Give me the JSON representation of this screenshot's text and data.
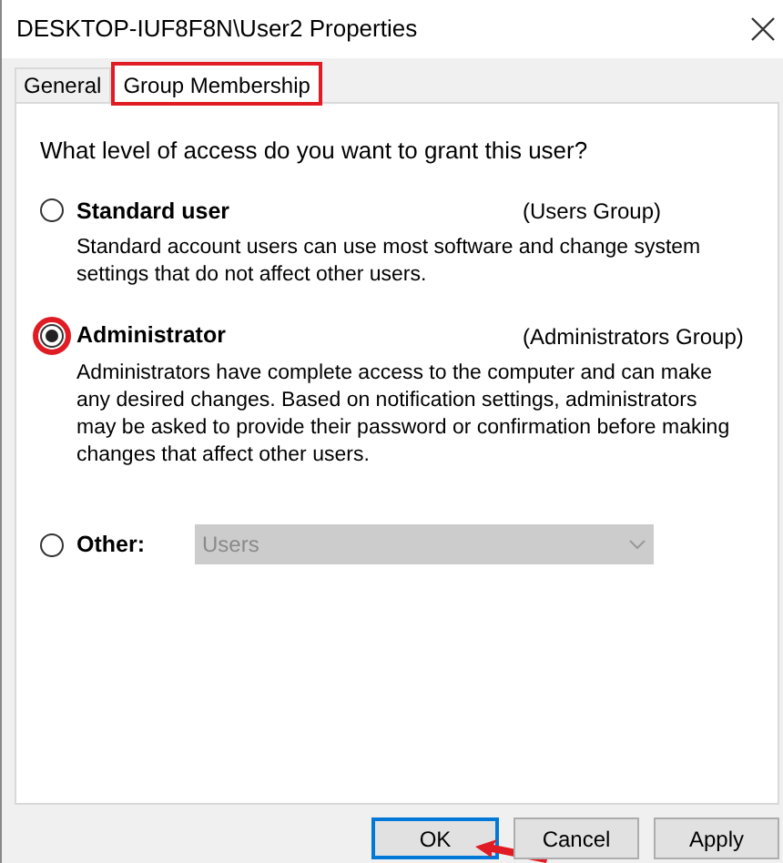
{
  "window": {
    "title": "DESKTOP-IUF8F8N\\User2 Properties"
  },
  "tabs": [
    {
      "label": "General",
      "selected": false,
      "highlighted": false
    },
    {
      "label": "Group Membership",
      "selected": true,
      "highlighted": true
    }
  ],
  "question": "What level of access do you want to grant this user?",
  "options": [
    {
      "kind": "described",
      "label": "Standard user",
      "group": "(Users Group)",
      "description": "Standard account users can use most software and change system settings that do not affect other users.",
      "selected": false,
      "highlighted": false
    },
    {
      "kind": "described",
      "label": "Administrator",
      "group": "(Administrators Group)",
      "description": "Administrators have complete access to the computer and can make any desired changes. Based on notification settings, administrators may be asked to provide their password or confirmation before making changes that affect other users.",
      "selected": true,
      "highlighted": true
    },
    {
      "kind": "dropdown",
      "label": "Other:",
      "value": "Users",
      "disabled": true,
      "selected": false,
      "highlighted": false
    }
  ],
  "buttons": [
    {
      "label": "OK",
      "default": true,
      "pointed": true
    },
    {
      "label": "Cancel",
      "default": false,
      "pointed": false
    },
    {
      "label": "Apply",
      "default": false,
      "pointed": false
    }
  ]
}
